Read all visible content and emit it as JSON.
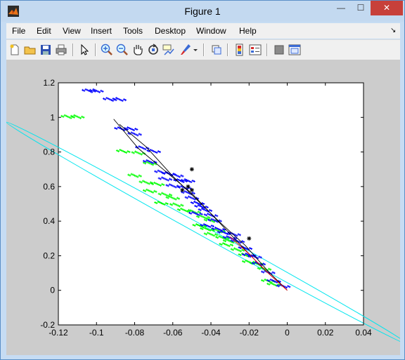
{
  "window": {
    "title": "Figure 1",
    "min_label": "—",
    "max_label": "☐",
    "close_label": "✕"
  },
  "menu": [
    "File",
    "Edit",
    "View",
    "Insert",
    "Tools",
    "Desktop",
    "Window",
    "Help"
  ],
  "toolbar": {
    "icons": [
      "new-figure-icon",
      "open-file-icon",
      "save-icon",
      "print-icon",
      "edit-plot-arrow-icon",
      "zoom-in-icon",
      "zoom-out-icon",
      "pan-hand-icon",
      "rotate-3d-icon",
      "data-cursor-icon",
      "brush-icon",
      "brush-dropdown-icon",
      "link-plot-icon",
      "insert-colorbar-icon",
      "insert-legend-icon",
      "hide-plot-tools-icon",
      "show-plot-tools-icon"
    ],
    "colors": {
      "accent_blue": "#3a6ad4",
      "red": "#d62a2a"
    }
  },
  "chart_data": {
    "type": "scatter",
    "title": "",
    "xlabel": "",
    "ylabel": "",
    "xlim": [
      -0.12,
      0.04
    ],
    "ylim": [
      -0.2,
      1.2
    ],
    "xticks": [
      "-0.12",
      "-0.1",
      "-0.08",
      "-0.06",
      "-0.04",
      "-0.02",
      "0",
      "0.02",
      "0.04"
    ],
    "yticks": [
      "-0.2",
      "0",
      "0.2",
      "0.4",
      "0.6",
      "0.8",
      "1",
      "1.2"
    ],
    "grid": false,
    "series": [
      {
        "color": "#0000ff",
        "marker": "+",
        "points": [
          [
            -0.104,
            1.15
          ],
          [
            -0.1,
            1.15
          ],
          [
            -0.093,
            1.1
          ],
          [
            -0.088,
            1.1
          ],
          [
            -0.087,
            0.93
          ],
          [
            -0.082,
            0.93
          ],
          [
            -0.08,
            0.9
          ],
          [
            -0.076,
            0.82
          ],
          [
            -0.07,
            0.8
          ],
          [
            -0.072,
            0.74
          ],
          [
            -0.066,
            0.68
          ],
          [
            -0.062,
            0.67
          ],
          [
            -0.058,
            0.66
          ],
          [
            -0.064,
            0.64
          ],
          [
            -0.056,
            0.63
          ],
          [
            -0.052,
            0.63
          ],
          [
            -0.06,
            0.6
          ],
          [
            -0.054,
            0.59
          ],
          [
            -0.052,
            0.56
          ],
          [
            -0.05,
            0.53
          ],
          [
            -0.047,
            0.5
          ],
          [
            -0.045,
            0.48
          ],
          [
            -0.043,
            0.46
          ],
          [
            -0.048,
            0.44
          ],
          [
            -0.04,
            0.43
          ],
          [
            -0.038,
            0.4
          ],
          [
            -0.042,
            0.37
          ],
          [
            -0.036,
            0.35
          ],
          [
            -0.033,
            0.33
          ],
          [
            -0.028,
            0.32
          ],
          [
            -0.03,
            0.3
          ],
          [
            -0.026,
            0.28
          ],
          [
            -0.022,
            0.24
          ],
          [
            -0.02,
            0.2
          ],
          [
            -0.017,
            0.19
          ],
          [
            -0.015,
            0.15
          ],
          [
            -0.01,
            0.1
          ],
          [
            -0.007,
            0.05
          ],
          [
            -0.002,
            0.02
          ]
        ]
      },
      {
        "color": "#00ff00",
        "marker": "+",
        "points": [
          [
            -0.115,
            1.0
          ],
          [
            -0.11,
            1.0
          ],
          [
            -0.086,
            0.8
          ],
          [
            -0.078,
            0.79
          ],
          [
            -0.072,
            0.73
          ],
          [
            -0.08,
            0.66
          ],
          [
            -0.074,
            0.62
          ],
          [
            -0.068,
            0.61
          ],
          [
            -0.072,
            0.57
          ],
          [
            -0.064,
            0.55
          ],
          [
            -0.06,
            0.53
          ],
          [
            -0.066,
            0.5
          ],
          [
            -0.058,
            0.49
          ],
          [
            -0.054,
            0.46
          ],
          [
            -0.049,
            0.45
          ],
          [
            -0.044,
            0.42
          ],
          [
            -0.04,
            0.4
          ],
          [
            -0.046,
            0.37
          ],
          [
            -0.042,
            0.35
          ],
          [
            -0.036,
            0.34
          ],
          [
            -0.04,
            0.32
          ],
          [
            -0.034,
            0.3
          ],
          [
            -0.03,
            0.28
          ],
          [
            -0.032,
            0.26
          ],
          [
            -0.026,
            0.23
          ],
          [
            -0.022,
            0.2
          ],
          [
            -0.02,
            0.16
          ],
          [
            -0.016,
            0.15
          ],
          [
            -0.012,
            0.12
          ],
          [
            -0.01,
            0.05
          ],
          [
            -0.007,
            0.03
          ]
        ]
      },
      {
        "color": "#000000",
        "marker": "*",
        "points": [
          [
            -0.05,
            0.7
          ],
          [
            -0.052,
            0.6
          ],
          [
            -0.05,
            0.58
          ],
          [
            -0.055,
            0.58
          ],
          [
            -0.02,
            0.3
          ]
        ]
      }
    ],
    "lines": [
      {
        "color": "#000000",
        "points": [
          [
            -0.091,
            0.99
          ],
          [
            -0.078,
            0.82
          ],
          [
            -0.064,
            0.69
          ],
          [
            -0.05,
            0.56
          ],
          [
            -0.038,
            0.42
          ],
          [
            -0.026,
            0.28
          ],
          [
            -0.013,
            0.13
          ],
          [
            0.0,
            0.0
          ]
        ]
      },
      {
        "color": "#000000",
        "points": [
          [
            -0.088,
            0.96
          ],
          [
            -0.074,
            0.83
          ],
          [
            -0.06,
            0.66
          ],
          [
            -0.047,
            0.52
          ],
          [
            -0.035,
            0.39
          ],
          [
            -0.022,
            0.26
          ],
          [
            -0.01,
            0.11
          ],
          [
            0.0,
            0.0
          ]
        ]
      },
      {
        "color": "#ff0000",
        "points": [
          [
            -0.03,
            0.31
          ],
          [
            -0.02,
            0.21
          ],
          [
            -0.01,
            0.1
          ],
          [
            0.0,
            0.0
          ]
        ]
      }
    ],
    "ellipse": {
      "color": "#00e5ee",
      "center": [
        -0.042,
        0.33
      ],
      "a": 0.083,
      "b": 0.1,
      "angle_deg": -63
    }
  }
}
